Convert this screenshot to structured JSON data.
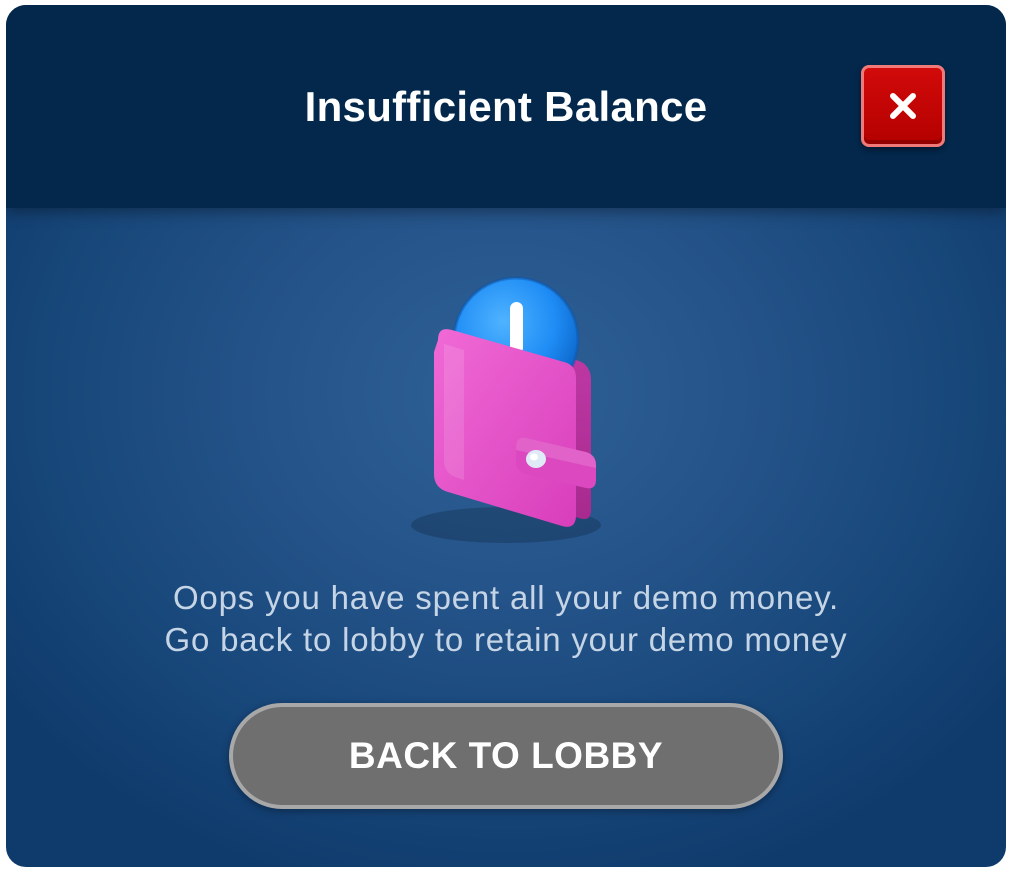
{
  "dialog": {
    "title": "Insufficient Balance",
    "close_icon": "close-icon",
    "illustration_icon": "wallet-alert-icon",
    "message_lines": [
      "Oops you have spent all your demo money.",
      "Go back to lobby to retain your demo money"
    ],
    "primary_button_label": "BACK TO LOBBY"
  },
  "colors": {
    "header_bg": "#03284c",
    "body_bg": "#1c4a7e",
    "close_button": "#c50404",
    "wallet": "#e64fc7",
    "alert_coin": "#1e8cf5",
    "button_bg": "#6f6f6f"
  }
}
